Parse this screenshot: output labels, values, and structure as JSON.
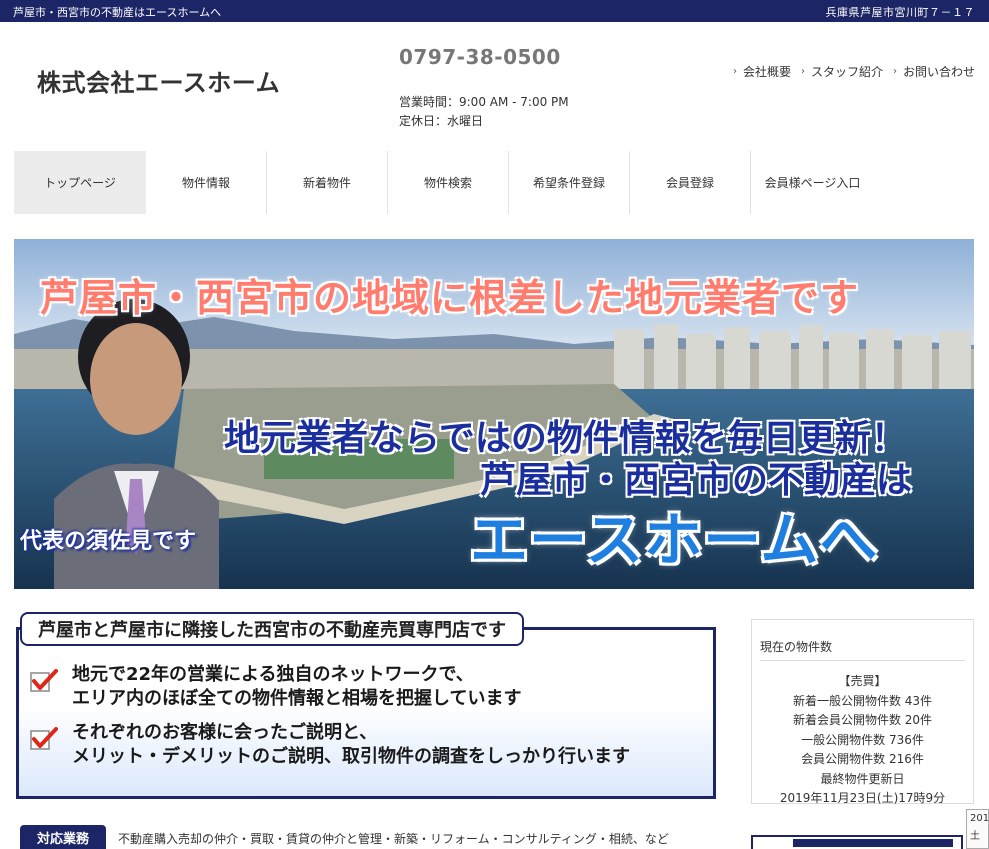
{
  "topbar": {
    "tagline": "芦屋市・西宮市の不動産はエースホームへ",
    "address": "兵庫県芦屋市宮川町７－１７"
  },
  "header": {
    "company": "株式会社エースホーム",
    "phone": "0797-38-0500",
    "hours": "営業時間：9:00 AM - 7:00 PM",
    "closed": "定休日：水曜日",
    "links": [
      {
        "label": "会社概要"
      },
      {
        "label": "スタッフ紹介"
      },
      {
        "label": "お問い合わせ"
      }
    ]
  },
  "nav": {
    "items": [
      {
        "label": "トップページ",
        "active": true
      },
      {
        "label": "物件情報"
      },
      {
        "label": "新着物件"
      },
      {
        "label": "物件検索"
      },
      {
        "label": "希望条件登録"
      },
      {
        "label": "会員登録"
      },
      {
        "label": "会員様ページ入口"
      }
    ]
  },
  "hero": {
    "line1": "芦屋市・西宮市の地域に根差した地元業者です",
    "line2": "地元業者ならではの物件情報を毎日更新！",
    "line3": "芦屋市・西宮市の不動産は",
    "line4": "エースホームへ",
    "caption": "代表の須佐見です"
  },
  "feature": {
    "heading": "芦屋市と芦屋市に隣接した西宮市の不動産売買専門店です",
    "points": [
      {
        "line1": "地元で22年の営業による独自のネットワークで、",
        "line2": "エリア内のほぼ全ての物件情報と相場を把握しています"
      },
      {
        "line1": "それぞれのお客様に会ったご説明と、",
        "line2": "メリット・デメリットのご説明、取引物件の調査をしっかり行います"
      }
    ]
  },
  "stock": {
    "title": "現在の物件数",
    "category": "【売買】",
    "new_public": "新着一般公開物件数 43件",
    "new_member": "新着会員公開物件数 20件",
    "public": "一般公開物件数 736件",
    "member": "会員公開物件数 216件",
    "updated_label": "最終物件更新日",
    "updated": "2019年11月23日(土)17時9分"
  },
  "business": {
    "label": "対応業務",
    "text": "不動産購入売却の仲介・買取・賃貸の仲介と管理・新築・リフォーム・コンサルティング・相続、など"
  },
  "date_chip": {
    "line1": "201",
    "line2": "土曜"
  },
  "colors": {
    "navy": "#1c2566",
    "hero_pink": "#ff7c6e",
    "hero_blue": "#1b2e9e",
    "hero_bright_blue": "#1f7fe0",
    "check_red": "#e0261a"
  },
  "icons": {
    "link_chevron": "chevron-right-icon",
    "feature_check": "checkmark-icon"
  }
}
